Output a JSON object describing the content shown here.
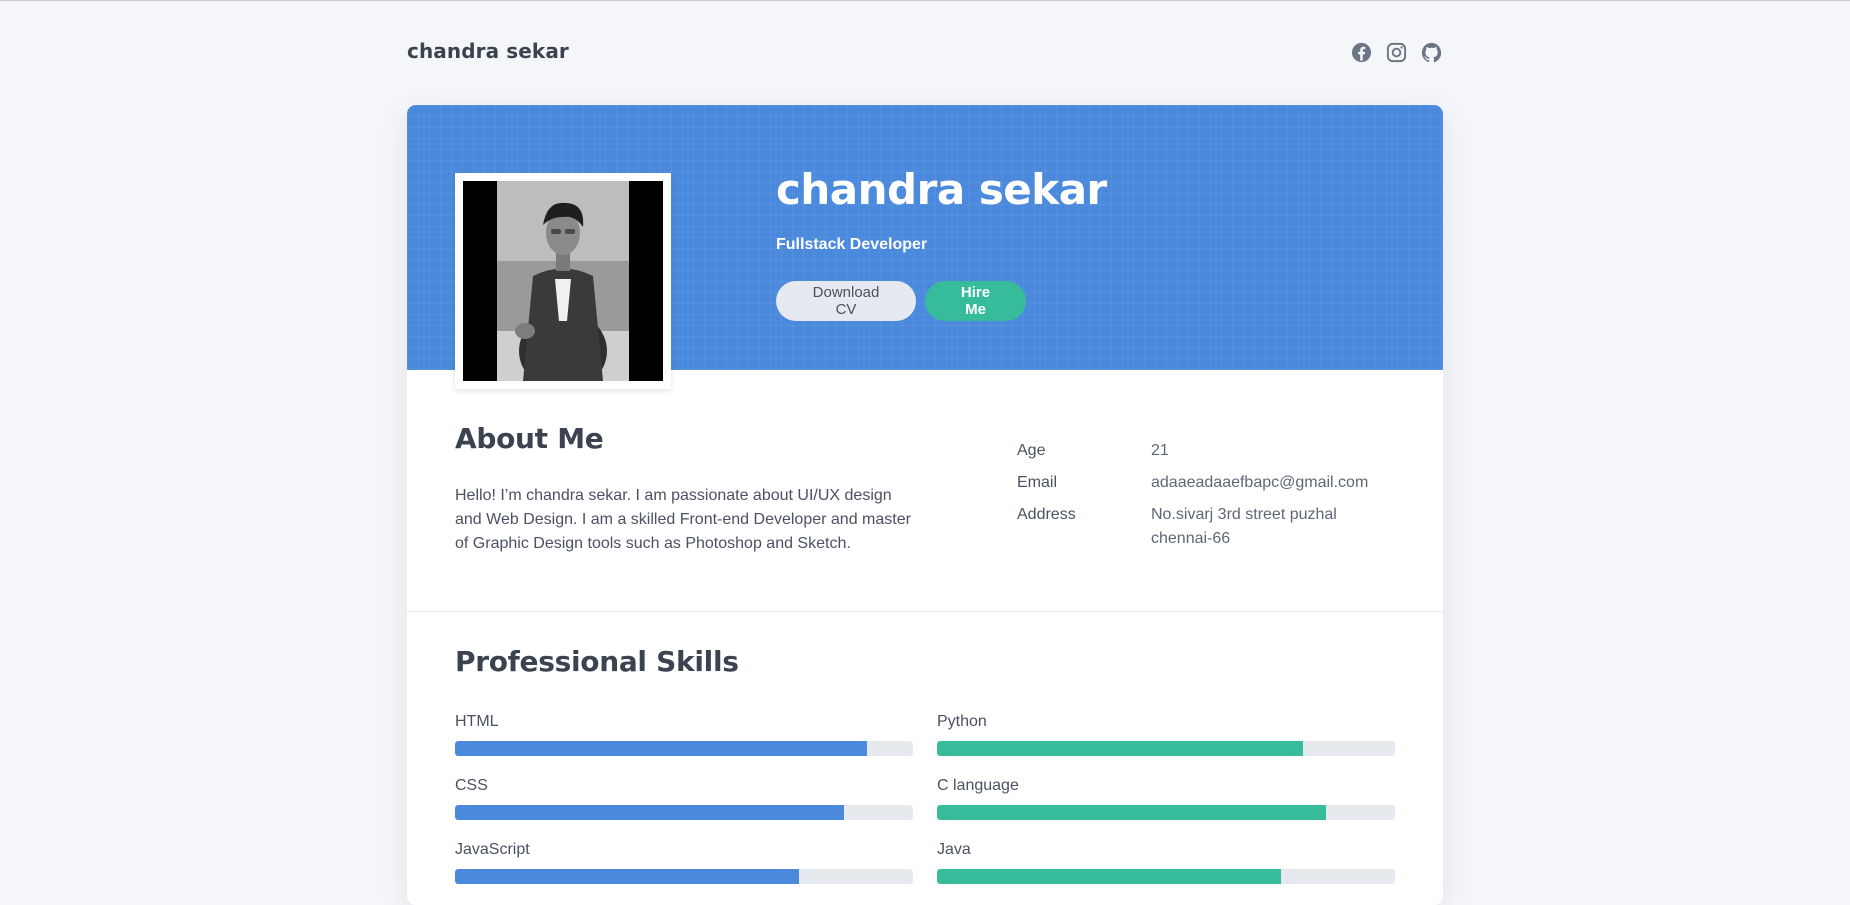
{
  "header": {
    "brand": "chandra sekar"
  },
  "social": [
    {
      "name": "facebook-icon",
      "label": "Facebook"
    },
    {
      "name": "instagram-icon",
      "label": "Instagram"
    },
    {
      "name": "github-icon",
      "label": "GitHub"
    }
  ],
  "hero": {
    "name": "chandra sekar",
    "role": "Fullstack Developer",
    "download_label": "Download CV",
    "hire_label": "Hire Me"
  },
  "about": {
    "title": "About Me",
    "text": "Hello! I’m chandra sekar. I am passionate about UI/UX design and Web Design. I am a skilled Front-end Developer and master of Graphic Design tools such as Photoshop and Sketch.",
    "info": [
      {
        "label": "Age",
        "value": "21"
      },
      {
        "label": "Email",
        "value": "adaaeadaaefbapc@gmail.com"
      },
      {
        "label": "Address",
        "value": "No.sivarj 3rd street puzhal chennai-66"
      }
    ]
  },
  "skills": {
    "title": "Professional Skills",
    "colors": {
      "left": "#4a89dc",
      "right": "#37bc9b"
    },
    "items": [
      {
        "name": "HTML",
        "level": 90,
        "column": "left"
      },
      {
        "name": "Python",
        "level": 80,
        "column": "right"
      },
      {
        "name": "CSS",
        "level": 85,
        "column": "left"
      },
      {
        "name": "C language",
        "level": 85,
        "column": "right"
      },
      {
        "name": "JavaScript",
        "level": 75,
        "column": "left"
      },
      {
        "name": "Java",
        "level": 75,
        "column": "right"
      }
    ]
  }
}
